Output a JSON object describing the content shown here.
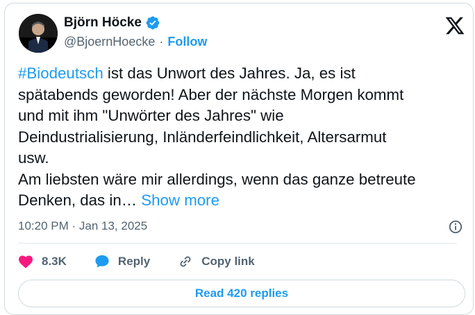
{
  "author": {
    "name": "Björn Höcke",
    "handle": "@BjoernHoecke",
    "separator": "·",
    "follow_label": "Follow"
  },
  "tweet": {
    "hashtag": "#Biodeutsch",
    "line1_rest": " ist das Unwort des Jahres. Ja, es ist",
    "line2": "spätabends geworden! Aber der nächste Morgen kommt",
    "line3": "und mit ihm \"Unwörter des Jahres\" wie",
    "line4": "Deindustrialisierung, Inländerfeindlichkeit, Altersarmut",
    "line5": "usw.",
    "line6": "Am liebsten wäre mir allerdings, wenn das ganze betreute",
    "line7": "Denken, das in… ",
    "show_more": "Show more"
  },
  "timestamp": "10:20 PM · Jan 13, 2025",
  "actions": {
    "likes": "8.3K",
    "reply": "Reply",
    "copy_link": "Copy link"
  },
  "read_replies": "Read 420 replies",
  "colors": {
    "accent": "#1d9bf0",
    "like": "#f91880",
    "muted": "#536471",
    "text": "#0f1419"
  },
  "icons": [
    "verified-badge-icon",
    "x-logo-icon",
    "info-icon",
    "heart-icon",
    "reply-bubble-icon",
    "link-icon"
  ]
}
